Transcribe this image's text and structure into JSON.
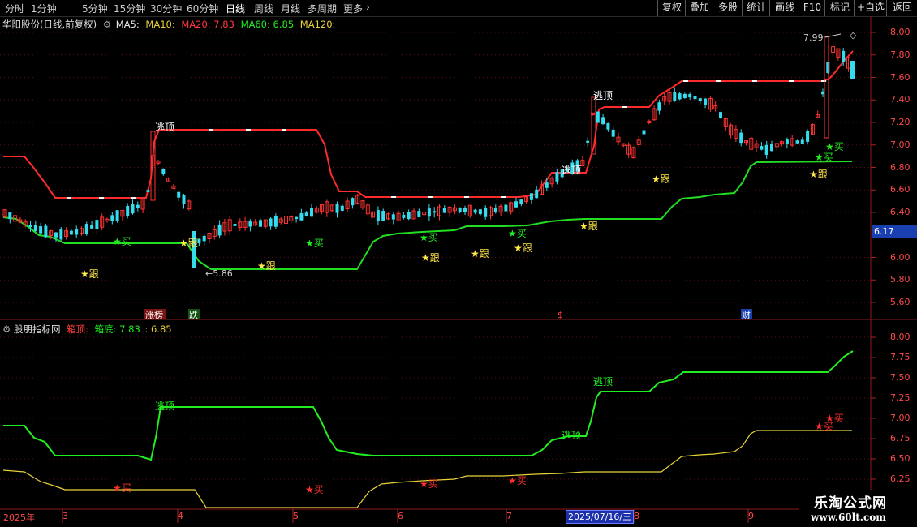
{
  "toolbar": {
    "periods": [
      "分时",
      "1分钟",
      "5分钟",
      "15分钟",
      "30分钟",
      "60分钟",
      "日线",
      "周线",
      "月线",
      "多周期",
      "更多"
    ],
    "active_period": "日线",
    "more_chevron": "›",
    "right_buttons": [
      "复权",
      "叠加",
      "多股",
      "统计",
      "画线",
      "F10",
      "标记",
      "+自选",
      "返回"
    ]
  },
  "main_chart": {
    "title": "华阳股份(日线,前复权)",
    "ma5": "MA5:",
    "ma10": "MA10:",
    "ma20": "MA20: 7.83",
    "ma60": "MA60: 6.85",
    "ma120": "MA120:",
    "y_ticks": [
      "8.00",
      "7.80",
      "7.60",
      "7.40",
      "7.20",
      "7.00",
      "6.80",
      "6.60",
      "6.40",
      "6.00",
      "5.80",
      "5.60"
    ],
    "current_price": "6.17",
    "high_label": "7.99",
    "low_label": "5.86",
    "signals": {
      "escape": "逃顶",
      "buy": "买",
      "follow": "跟"
    },
    "event_markers": [
      "涨榜",
      "跌",
      "$",
      "财"
    ]
  },
  "sub_chart": {
    "title": "股朋指标网",
    "box_top_label": "箱顶:",
    "box_bottom_label": "箱底: 7.83",
    "extra_value": ": 6.85",
    "y_ticks": [
      "8.00",
      "7.75",
      "7.50",
      "7.25",
      "7.00",
      "6.75",
      "6.50",
      "6.25"
    ]
  },
  "date_axis": {
    "year": "2025年",
    "months": [
      "3",
      "4",
      "5",
      "6",
      "7",
      "8",
      "9"
    ],
    "highlight": "2025/07/16/三"
  },
  "watermark": {
    "name": "乐淘公式网",
    "url": "www.60lt.com"
  },
  "colors": {
    "background": "#000000",
    "up": "#ff3333",
    "down": "#33ddee",
    "box_top_main": "#ff2a2a",
    "box_bottom_main": "#22dd22",
    "sub_top": "#22ee22",
    "sub_bottom": "#e8d23a",
    "grid": "#5a1010"
  }
}
